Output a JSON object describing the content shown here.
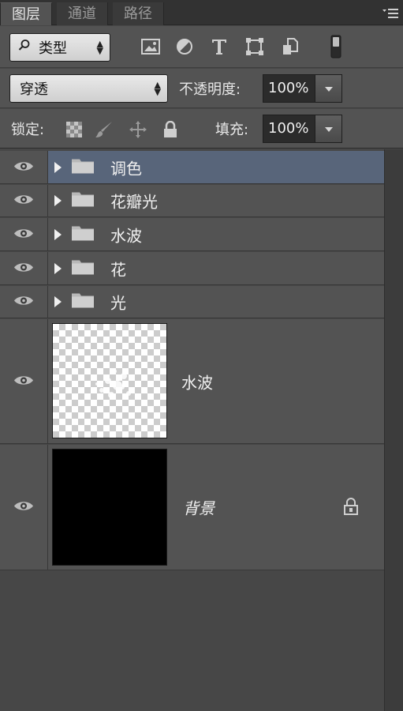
{
  "tabs": [
    {
      "label": "图层",
      "active": true
    },
    {
      "label": "通道",
      "active": false
    },
    {
      "label": "路径",
      "active": false
    }
  ],
  "filter": {
    "kind_label": "类型",
    "icons": [
      "image-filter-icon",
      "adjustment-filter-icon",
      "type-filter-icon",
      "shape-filter-icon",
      "smart-object-filter-icon",
      "filter-toggle-icon"
    ]
  },
  "blend": {
    "mode": "穿透",
    "opacity_label": "不透明度:",
    "opacity_value": "100%"
  },
  "lock": {
    "label": "锁定:",
    "icons": [
      "lock-transparent-icon",
      "lock-pixels-icon",
      "lock-position-icon",
      "lock-all-icon"
    ],
    "fill_label": "填充:",
    "fill_value": "100%"
  },
  "layers": [
    {
      "name": "调色",
      "type": "group",
      "selected": true,
      "visible": true
    },
    {
      "name": "花瓣光",
      "type": "group",
      "selected": false,
      "visible": true
    },
    {
      "name": "水波",
      "type": "group",
      "selected": false,
      "visible": true
    },
    {
      "name": "花",
      "type": "group",
      "selected": false,
      "visible": true
    },
    {
      "name": "光",
      "type": "group",
      "selected": false,
      "visible": true
    },
    {
      "name": "水波",
      "type": "pixel",
      "selected": false,
      "visible": true
    },
    {
      "name": "背景",
      "type": "background",
      "selected": false,
      "visible": true,
      "locked": true
    }
  ],
  "colors": {
    "panel_bg": "#535353",
    "selected_row": "#58657a",
    "background_fill": "#000000"
  }
}
